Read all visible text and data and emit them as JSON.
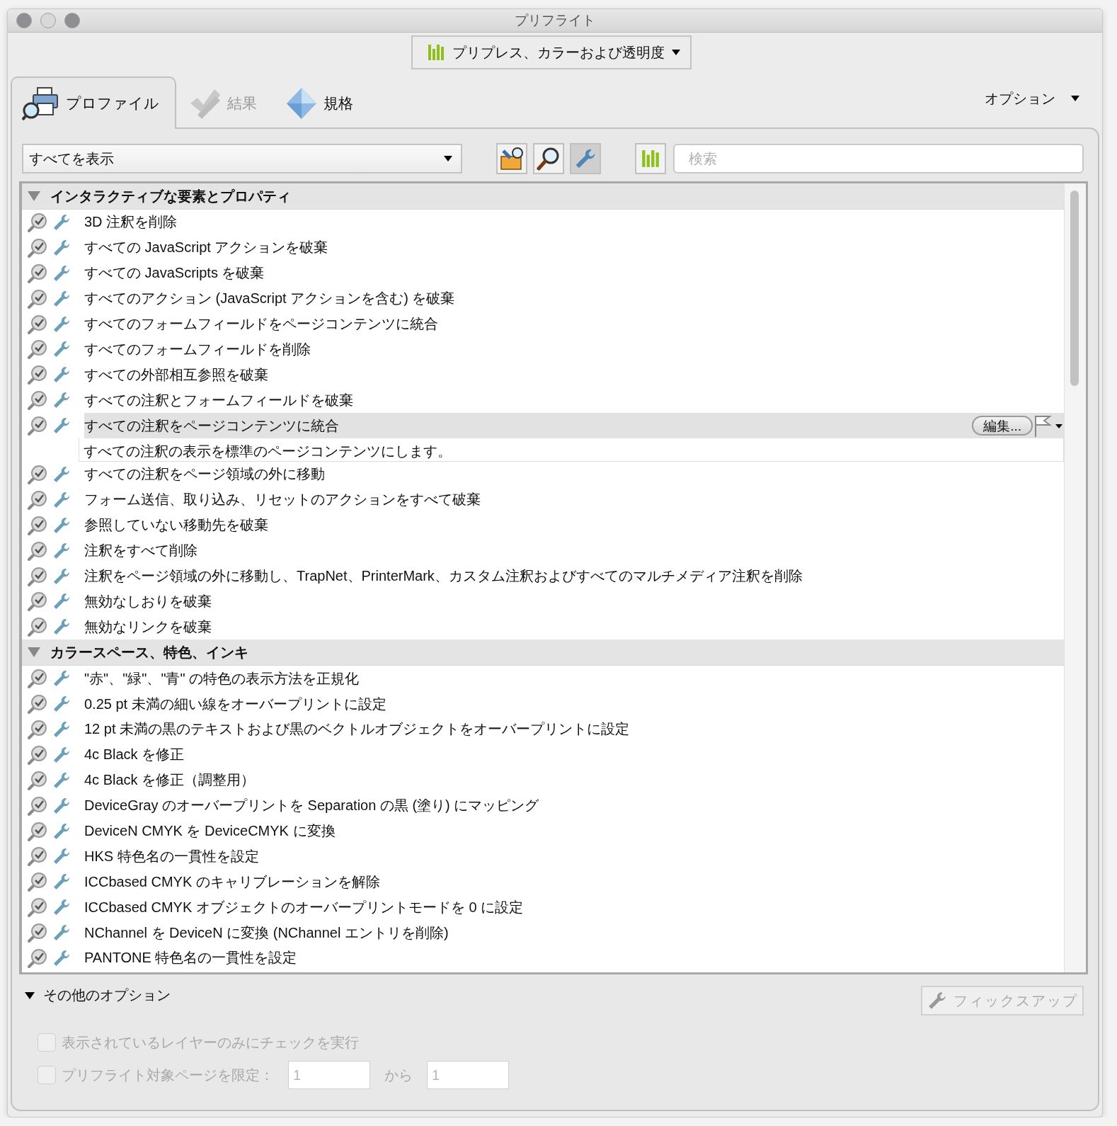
{
  "window": {
    "title": "プリフライト"
  },
  "preset": {
    "label": "プリプレス、カラーおよび透明度"
  },
  "tabs": [
    {
      "label": "プロファイル",
      "selected": true,
      "disabled": false
    },
    {
      "label": "結果",
      "selected": false,
      "disabled": true
    },
    {
      "label": "規格",
      "selected": false,
      "disabled": false
    }
  ],
  "options_menu": {
    "label": "オプション"
  },
  "filter": {
    "value": "すべてを表示"
  },
  "toolbar_buttons": [
    {
      "selected": false
    },
    {
      "selected": false
    },
    {
      "selected": true
    },
    {
      "selected": false
    }
  ],
  "search": {
    "placeholder": "検索"
  },
  "sections": [
    {
      "title": "インタラクティブな要素とプロパティ",
      "expanded": true,
      "items": [
        {
          "label": "3D 注釈を削除",
          "selected": false
        },
        {
          "label": "すべての JavaScript アクションを破棄",
          "selected": false
        },
        {
          "label": "すべての JavaScripts を破棄",
          "selected": false
        },
        {
          "label": "すべてのアクション (JavaScript アクションを含む) を破棄",
          "selected": false
        },
        {
          "label": "すべてのフォームフィールドをページコンテンツに統合",
          "selected": false
        },
        {
          "label": "すべてのフォームフィールドを削除",
          "selected": false
        },
        {
          "label": "すべての外部相互参照を破棄",
          "selected": false
        },
        {
          "label": "すべての注釈とフォームフィールドを破棄",
          "selected": false
        },
        {
          "label": "すべての注釈をページコンテンツに統合",
          "selected": true,
          "description": "すべての注釈の表示を標準のページコンテンツにします。"
        },
        {
          "label": "すべての注釈をページ領域の外に移動",
          "selected": false
        },
        {
          "label": "フォーム送信、取り込み、リセットのアクションをすべて破棄",
          "selected": false
        },
        {
          "label": "参照していない移動先を破棄",
          "selected": false
        },
        {
          "label": "注釈をすべて削除",
          "selected": false
        },
        {
          "label": "注釈をページ領域の外に移動し、TrapNet、PrinterMark、カスタム注釈およびすべてのマルチメディア注釈を削除",
          "selected": false
        },
        {
          "label": "無効なしおりを破棄",
          "selected": false
        },
        {
          "label": "無効なリンクを破棄",
          "selected": false
        }
      ]
    },
    {
      "title": "カラースペース、特色、インキ",
      "expanded": true,
      "items": [
        {
          "label": "\"赤\"、\"緑\"、\"青\" の特色の表示方法を正規化",
          "selected": false
        },
        {
          "label": "0.25 pt 未満の細い線をオーバープリントに設定",
          "selected": false
        },
        {
          "label": "12 pt 未満の黒のテキストおよび黒のベクトルオブジェクトをオーバープリントに設定",
          "selected": false
        },
        {
          "label": "4c Black を修正",
          "selected": false
        },
        {
          "label": "4c Black を修正（調整用）",
          "selected": false
        },
        {
          "label": "DeviceGray のオーバープリントを Separation の黒 (塗り) にマッピング",
          "selected": false
        },
        {
          "label": "DeviceN CMYK を DeviceCMYK に変換",
          "selected": false
        },
        {
          "label": "HKS 特色名の一貫性を設定",
          "selected": false
        },
        {
          "label": "ICCbased CMYK のキャリブレーションを解除",
          "selected": false
        },
        {
          "label": "ICCbased CMYK オブジェクトのオーバープリントモードを 0 に設定",
          "selected": false
        },
        {
          "label": "NChannel を DeviceN に変換 (NChannel エントリを削除)",
          "selected": false
        },
        {
          "label": "PANTONE 特色名の一貫性を設定",
          "selected": false
        }
      ]
    }
  ],
  "edit_button": {
    "label": "編集..."
  },
  "more_options": {
    "label": "その他のオプション",
    "expanded": true
  },
  "fixup_button": {
    "label": "フィックスアップ",
    "disabled": true
  },
  "layer_check": {
    "label": "表示されているレイヤーのみにチェックを実行",
    "checked": false,
    "disabled": true
  },
  "page_limit": {
    "label": "プリフライト対象ページを限定：",
    "checked": false,
    "disabled": true,
    "from": "1",
    "separator": "から",
    "to": "1"
  }
}
